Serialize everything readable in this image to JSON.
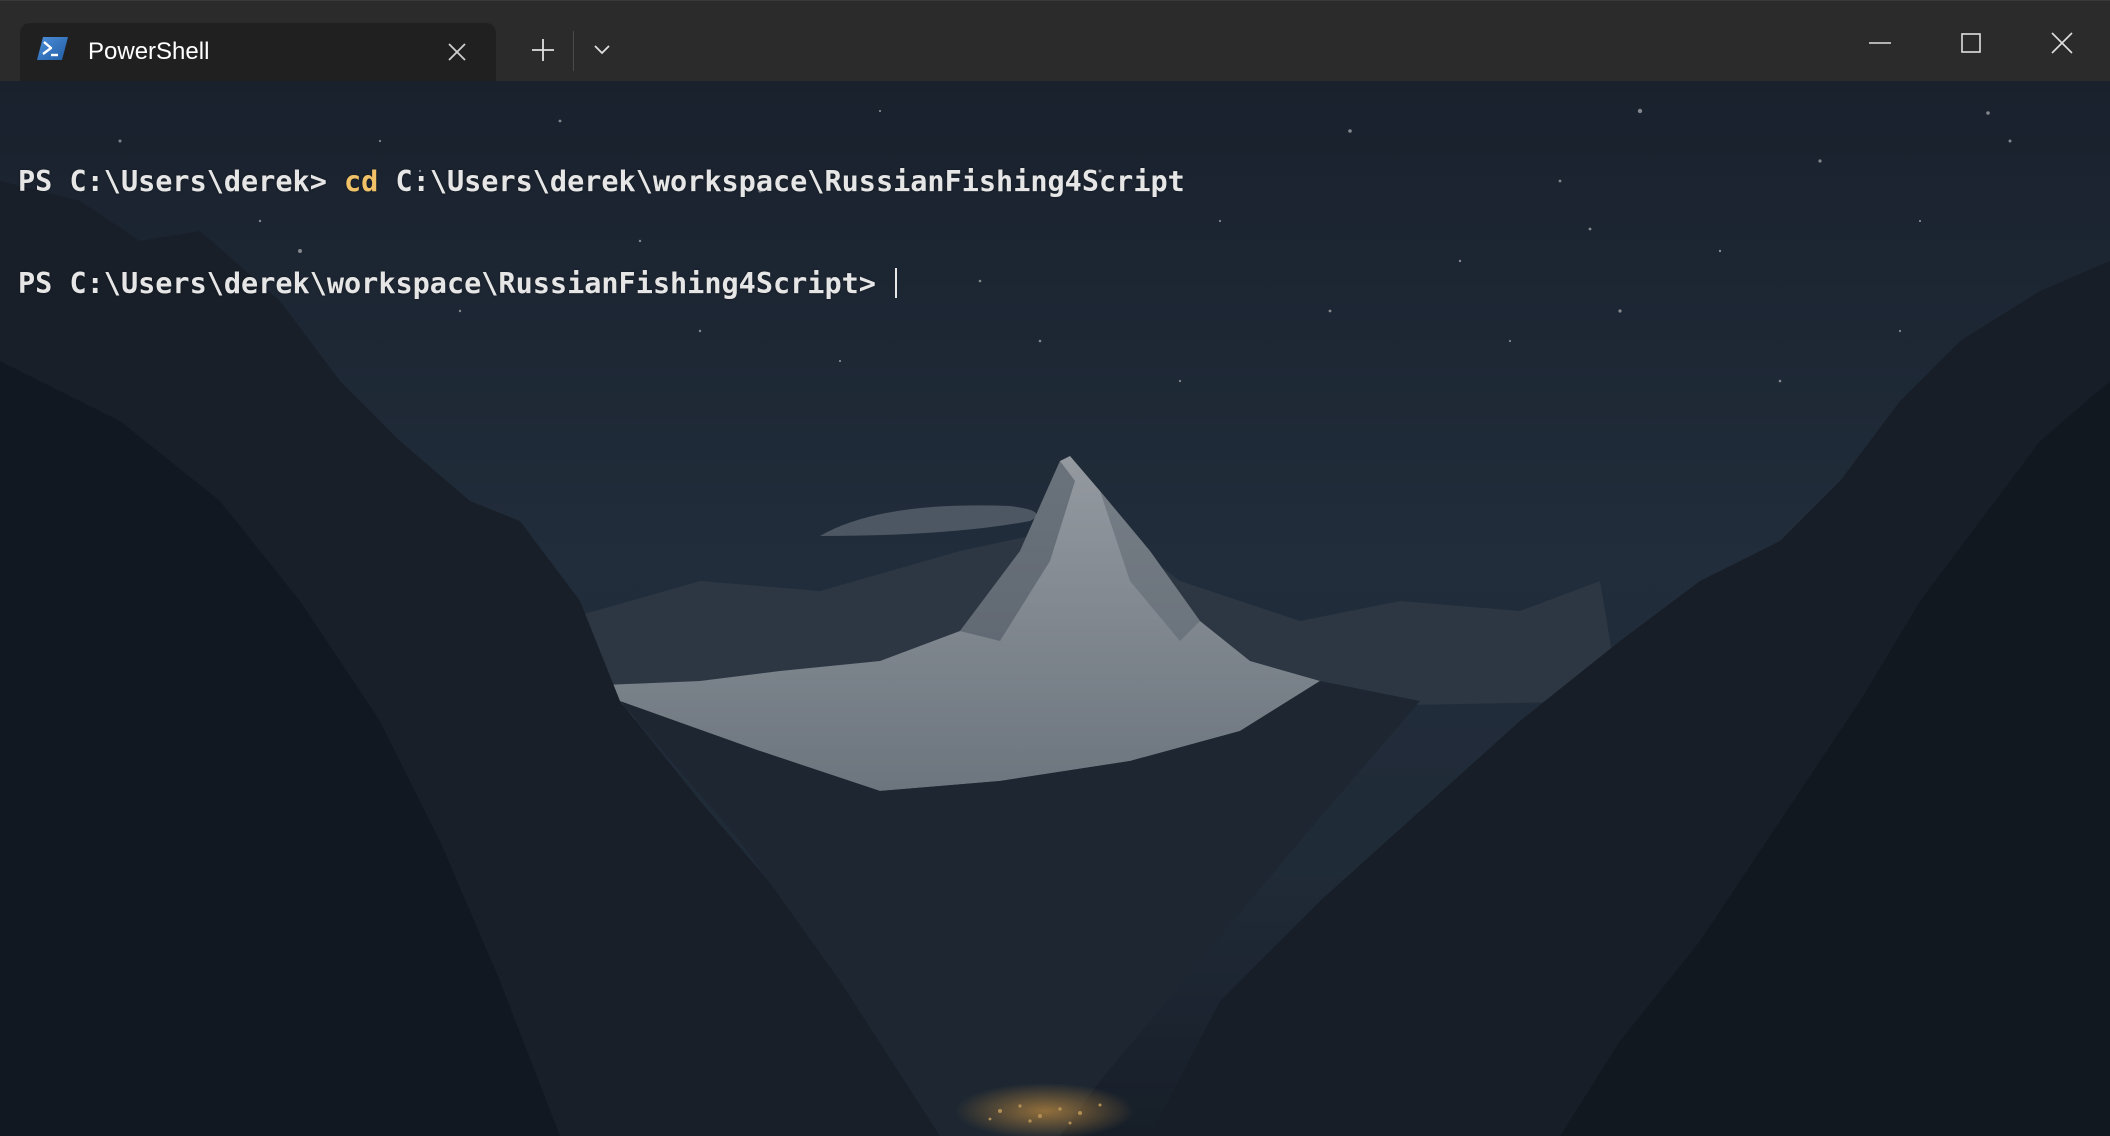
{
  "tab": {
    "title": "PowerShell",
    "icon": "powershell-icon"
  },
  "titlebar": {
    "new_tab_icon": "plus-icon",
    "dropdown_icon": "chevron-down-icon",
    "close_tab_icon": "close-icon",
    "minimize_icon": "minimize-icon",
    "maximize_icon": "maximize-icon",
    "close_window_icon": "close-icon"
  },
  "terminal": {
    "background": "mountain-night-sky-wallpaper",
    "lines": [
      {
        "prompt": "PS C:\\Users\\derek> ",
        "command": "cd",
        "args": " C:\\Users\\derek\\workspace\\RussianFishing4Script"
      },
      {
        "prompt": "PS C:\\Users\\derek\\workspace\\RussianFishing4Script> ",
        "command": "",
        "args": ""
      }
    ]
  },
  "colors": {
    "titlebar": "#2b2b2b",
    "tab_active": "#202020",
    "prompt_text": "#e6e6e6",
    "command_keyword": "#f2c268"
  }
}
